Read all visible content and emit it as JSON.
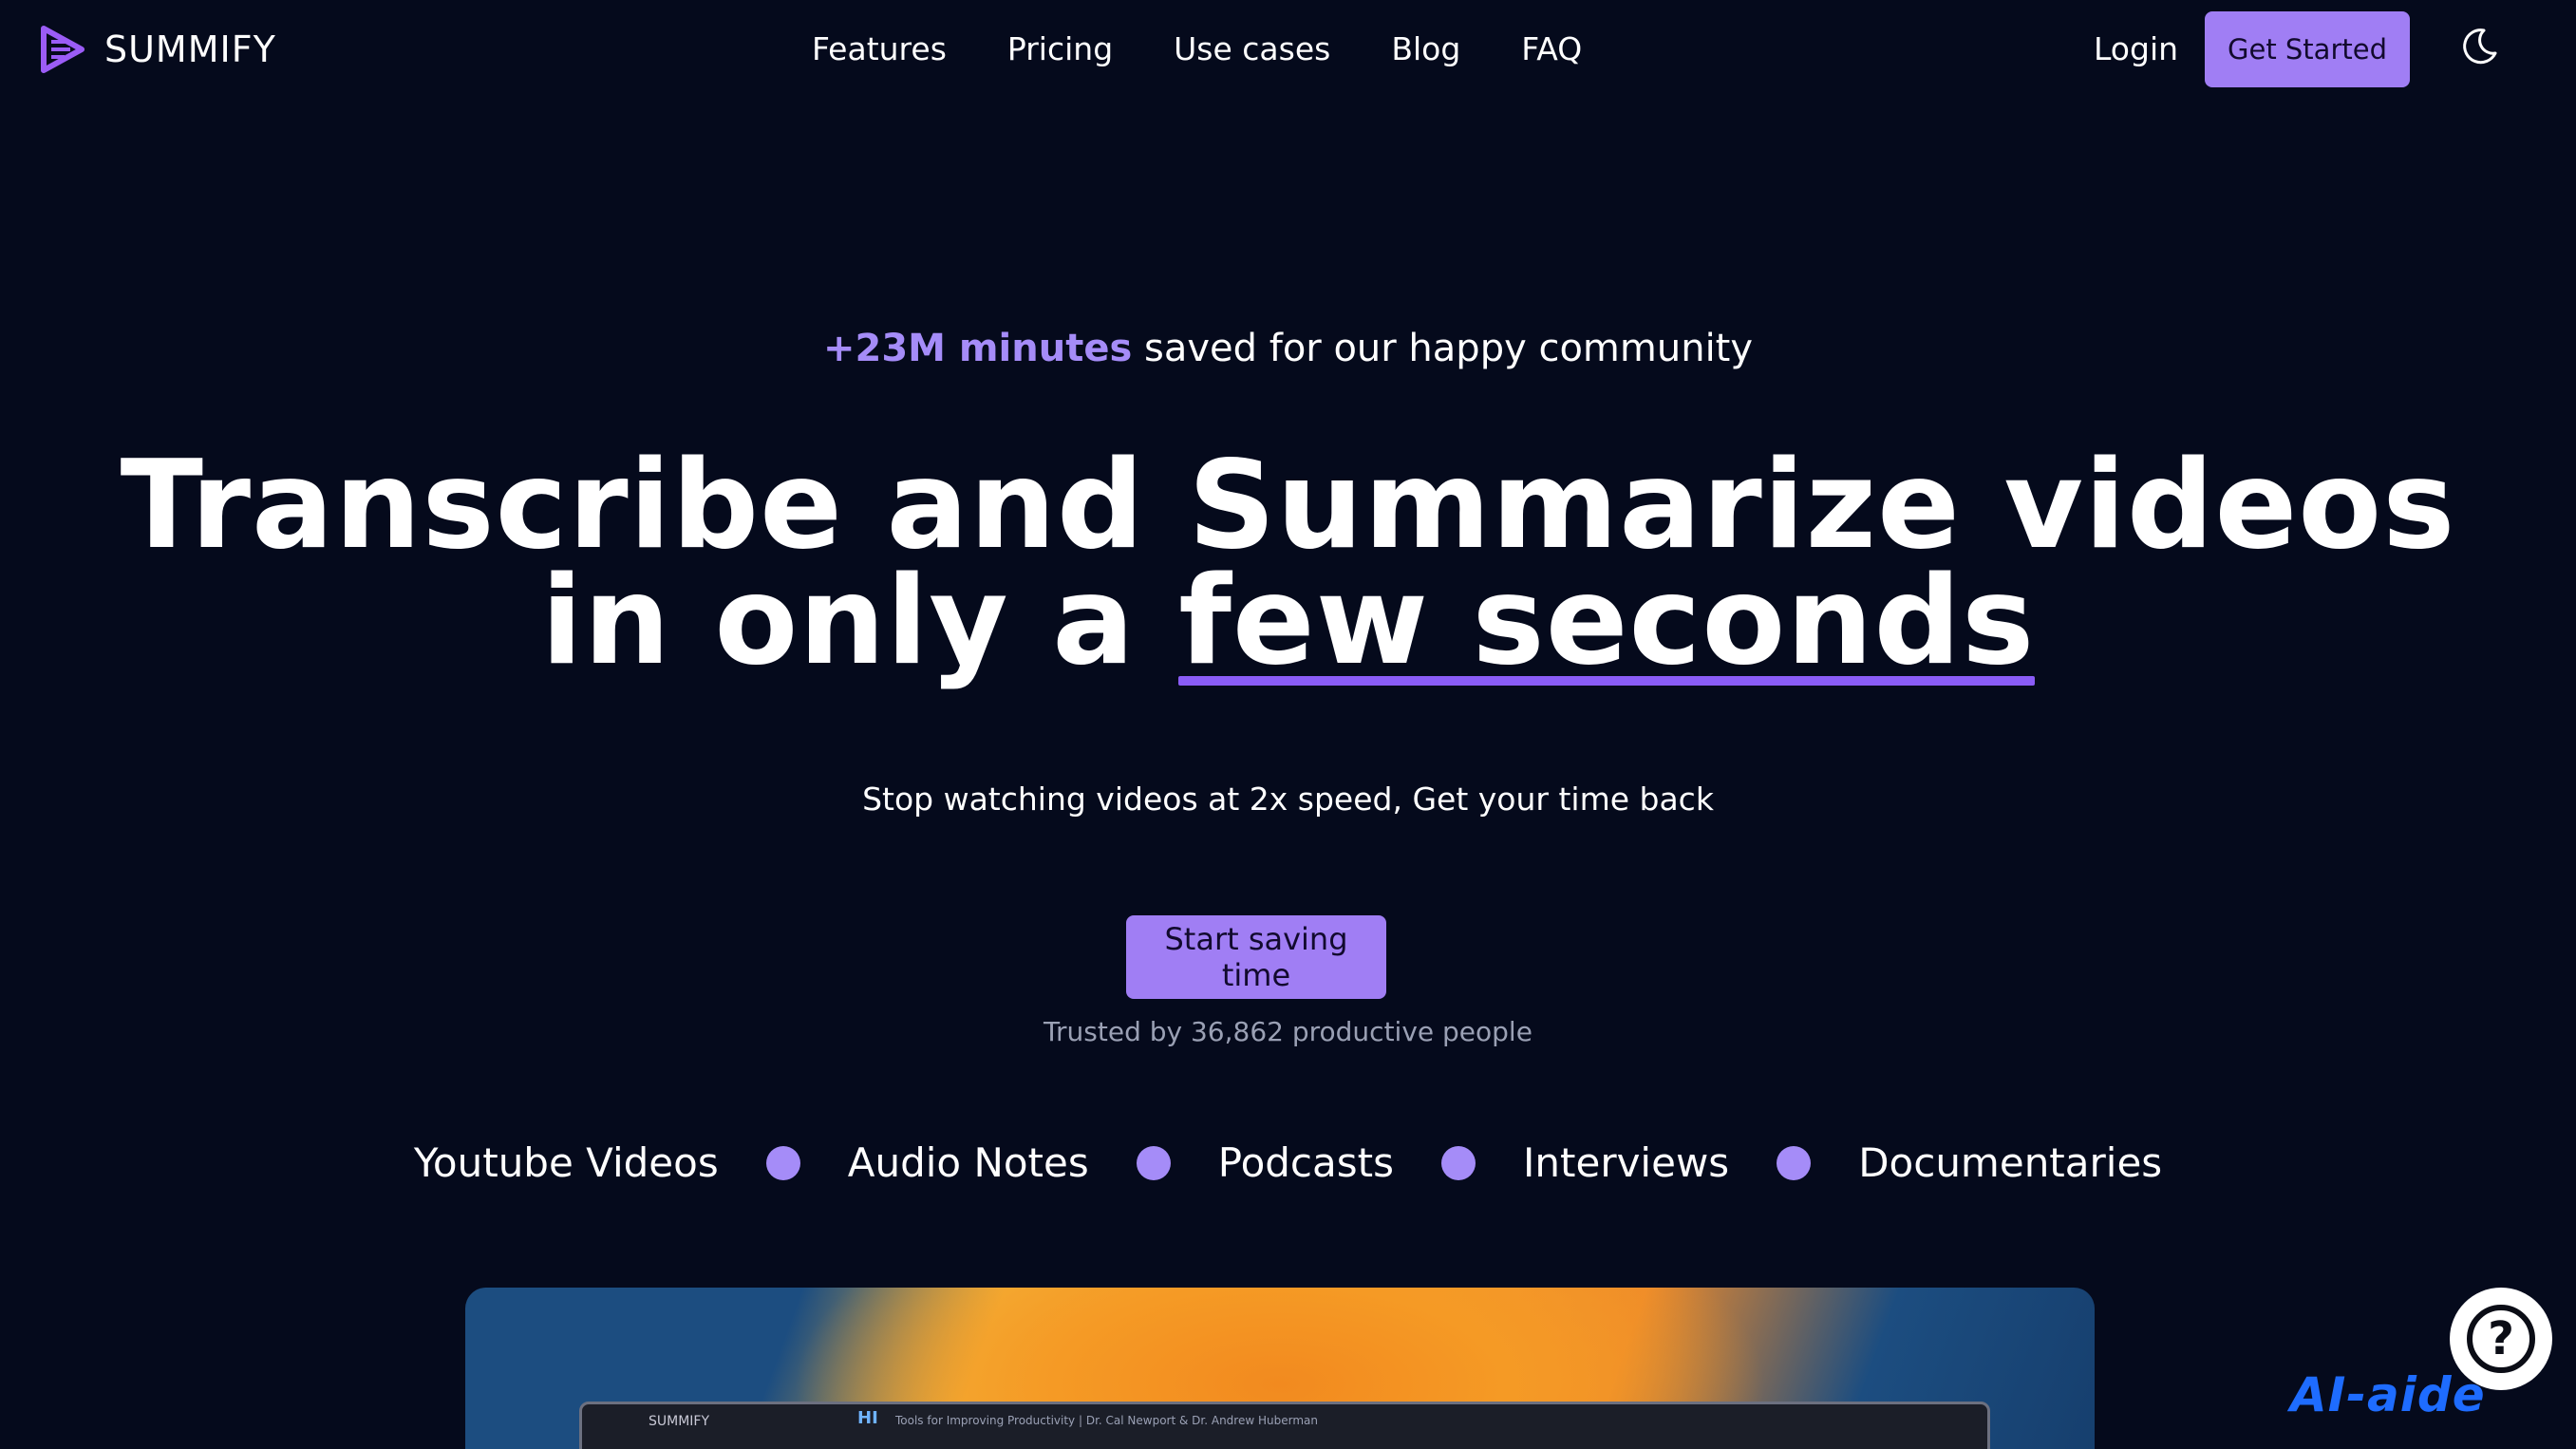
{
  "brand": {
    "name": "SUMMIFY",
    "accent": "#a07ef4",
    "background": "#050a1c"
  },
  "nav": {
    "links": [
      "Features",
      "Pricing",
      "Use cases",
      "Blog",
      "FAQ"
    ],
    "login": "Login",
    "get_started": "Get Started",
    "theme_icon": "moon-icon"
  },
  "hero": {
    "tagline_highlight": "+23M minutes",
    "tagline_rest": " saved for our happy community",
    "headline_line1": "Transcribe and Summarize videos",
    "headline_line2_prefix": "in only a ",
    "headline_line2_underlined": "few seconds",
    "subtitle": "Stop watching videos at 2x speed, Get your time back",
    "cta": "Start saving time",
    "trusted": "Trusted by 36,862 productive people"
  },
  "categories": [
    "Youtube Videos",
    "Audio Notes",
    "Podcasts",
    "Interviews",
    "Documentaries"
  ],
  "preview": {
    "app_logo": "SUMMIFY",
    "tab_badge": "HI",
    "video_title": "Tools for Improving Productivity | Dr. Cal Newport & Dr. Andrew Huberman"
  },
  "help": {
    "icon": "help-icon",
    "label": "?"
  },
  "watermark": "AI-aide"
}
